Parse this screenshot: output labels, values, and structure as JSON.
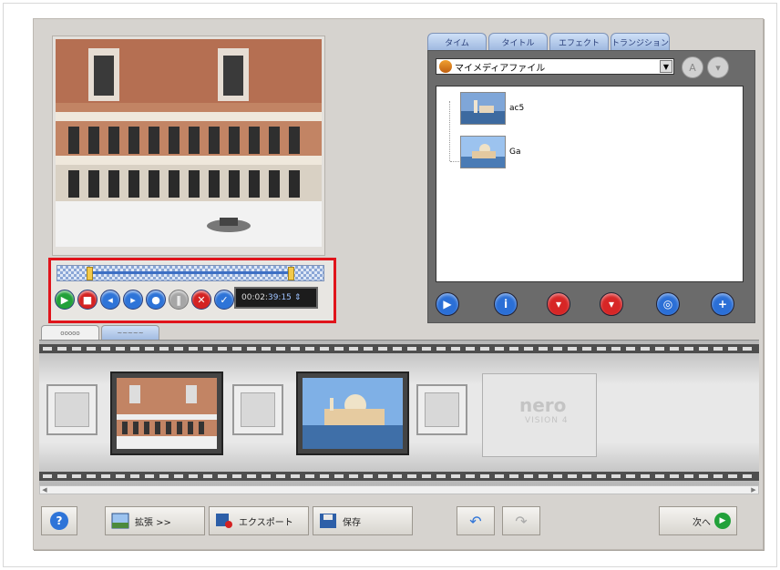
{
  "media_tabs": [
    "タイム",
    "タイトル",
    "エフェクト",
    "トランジション"
  ],
  "browser": {
    "dropdown_value": "マイメディアファイル",
    "files": [
      {
        "name": "ac5"
      },
      {
        "name": "Ga"
      }
    ]
  },
  "player": {
    "timecode_main": "00:02:",
    "timecode_frames": "39:15"
  },
  "strip_tabs": [
    "ooooo",
    "~~~~~"
  ],
  "nero_logo": {
    "word": "nero",
    "sub": "VISION 4"
  },
  "bottom_bar": {
    "expand_label": "拡張 >>",
    "export_label": "エクスポート",
    "save_label": "保存",
    "next_label": "次へ"
  },
  "colors": {
    "highlight": "#e0141b",
    "panel": "#d6d3cf",
    "accent_blue": "#2e74d8"
  }
}
